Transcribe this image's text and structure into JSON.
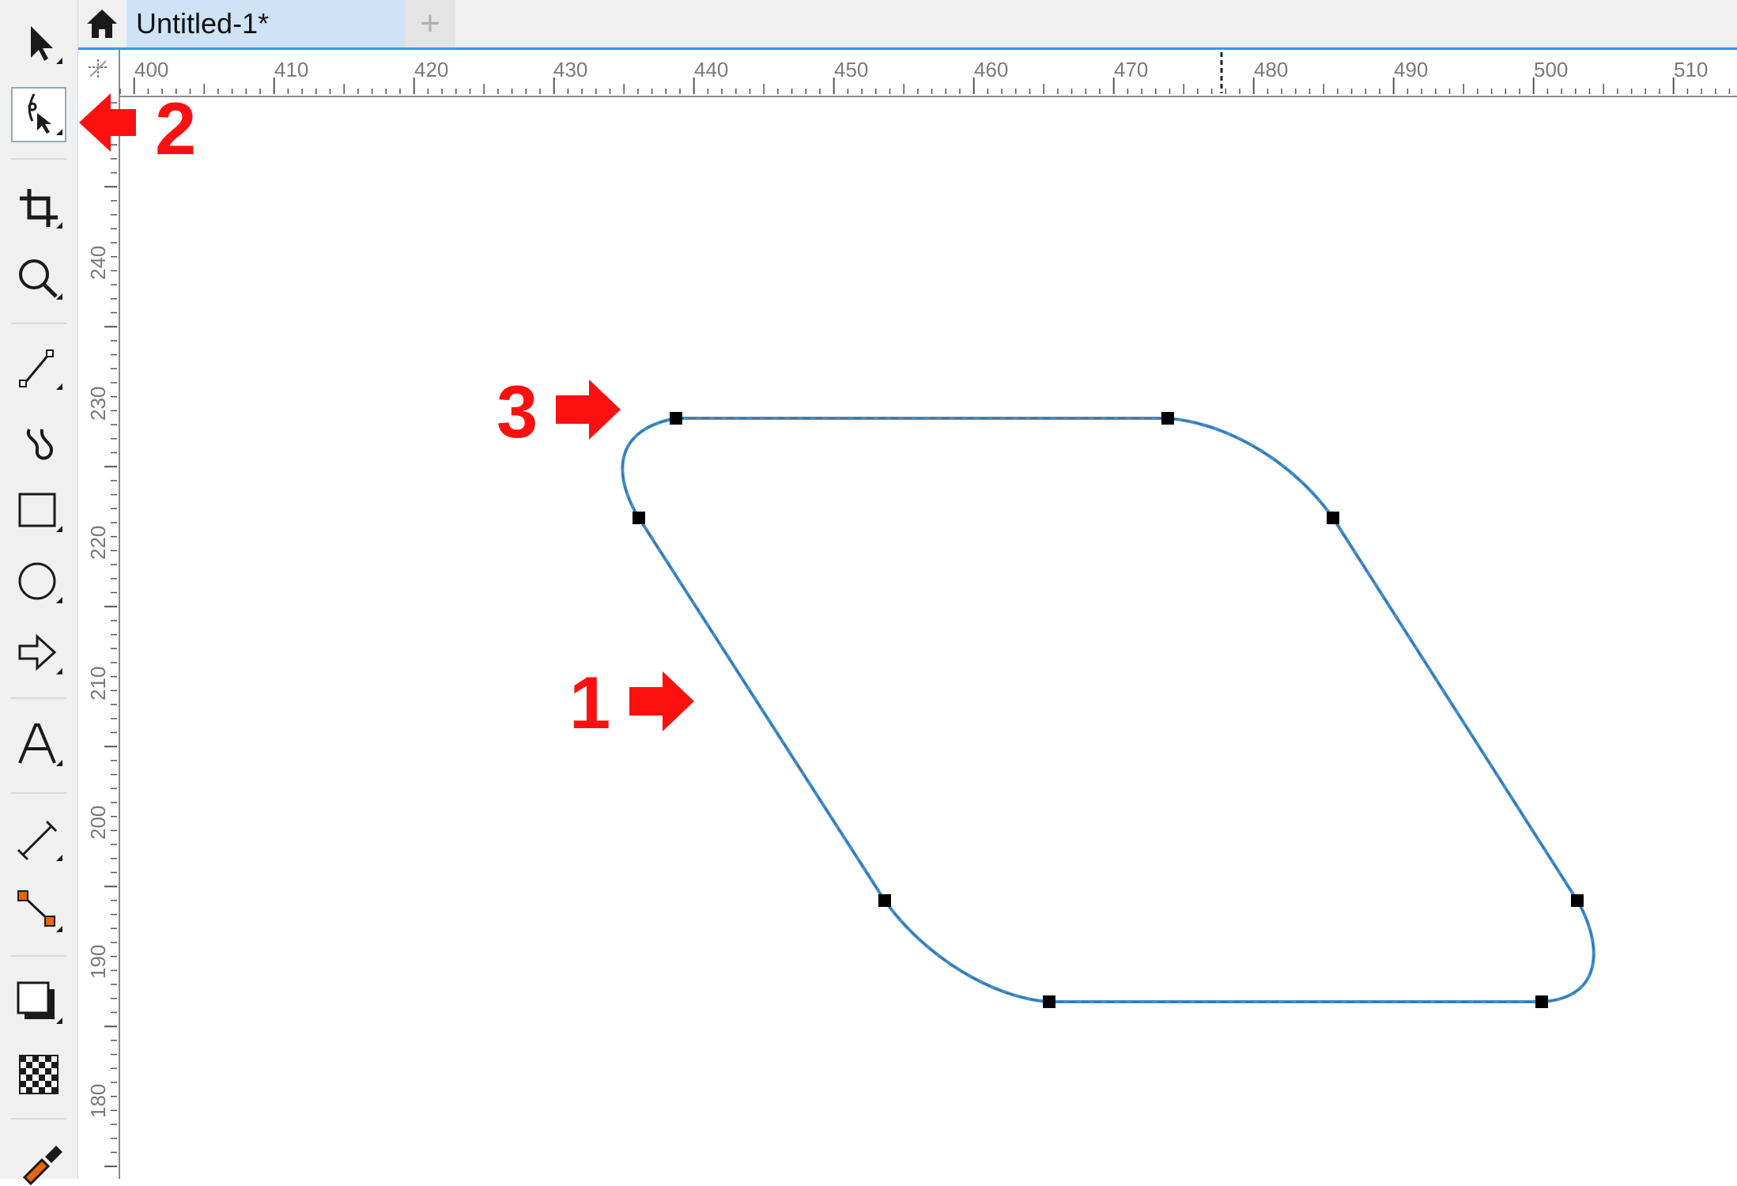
{
  "tabs": {
    "home_icon": "home-icon",
    "document_tab_label": "Untitled-1*",
    "new_tab_symbol": "+"
  },
  "rulers": {
    "horizontal_labels": [
      "400",
      "410",
      "420",
      "430",
      "440",
      "450",
      "460",
      "470",
      "480",
      "490",
      "500",
      "510"
    ],
    "vertical_labels": [
      "240",
      "230",
      "220",
      "210",
      "200",
      "190",
      "180"
    ]
  },
  "toolbox": {
    "tools": [
      {
        "name": "pick-tool",
        "icon": "arrow-pointer-icon"
      },
      {
        "name": "shape-tool",
        "icon": "shape-node-icon",
        "active": true
      },
      {
        "name": "crop-tool",
        "icon": "crop-icon"
      },
      {
        "name": "zoom-tool",
        "icon": "magnifier-icon"
      },
      {
        "name": "freehand-tool",
        "icon": "freehand-line-icon"
      },
      {
        "name": "artistic-media-tool",
        "icon": "curve-icon"
      },
      {
        "name": "rectangle-tool",
        "icon": "rectangle-icon"
      },
      {
        "name": "ellipse-tool",
        "icon": "ellipse-icon"
      },
      {
        "name": "common-shapes-tool",
        "icon": "arrow-shape-icon"
      },
      {
        "name": "text-tool",
        "icon": "text-a-icon"
      },
      {
        "name": "parallel-dimension-tool",
        "icon": "dimension-line-icon"
      },
      {
        "name": "connector-tool",
        "icon": "connector-icon"
      },
      {
        "name": "drop-shadow-tool",
        "icon": "drop-shadow-icon"
      },
      {
        "name": "transparency-tool",
        "icon": "checkerboard-icon"
      },
      {
        "name": "color-eyedropper-tool",
        "icon": "eyedropper-icon"
      }
    ]
  },
  "annotations": {
    "callout_1": "1",
    "callout_2": "2",
    "callout_3": "3"
  },
  "colors": {
    "callout": "#ff1010",
    "selection_outline": "#3a8fd6",
    "tab_active_bg": "#cfe3f7",
    "tab_accent": "#29a0e6"
  }
}
